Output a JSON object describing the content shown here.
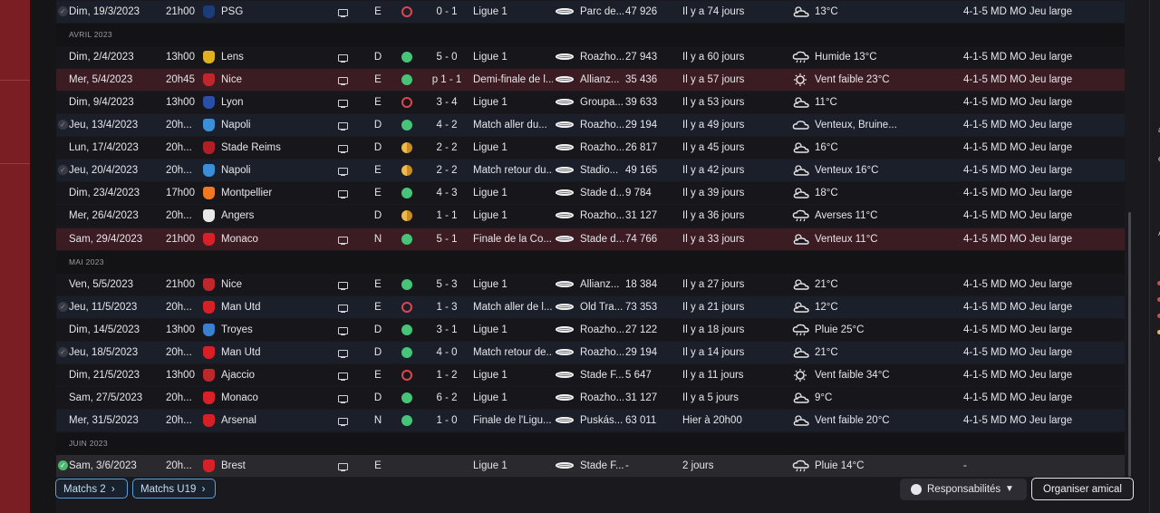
{
  "colors": {
    "accent_red": "#7a1e24",
    "win": "#45c47a",
    "loss": "#e0444f",
    "draw": "#f0b94a",
    "link_blue": "#5aa0d8"
  },
  "rows": [
    {
      "type": "match",
      "date": "Dim, 19/3/2023",
      "time": "21h00",
      "opponent": "PSG",
      "crest_color": "#1b3b7a",
      "venue": "E",
      "result": "l",
      "score": "0 - 1",
      "competition": "Ligue 1",
      "stadium": "Parc de...",
      "attendance": "47 926",
      "ago": "Il y a 74 jours",
      "weather": "13°C",
      "weather_icon": "cloud-sun-icon",
      "tactic": "4-1-5 MD MO Jeu large",
      "bg": "away",
      "check": true,
      "tv": true
    },
    {
      "type": "month",
      "label": "AVRIL 2023"
    },
    {
      "type": "match",
      "date": "Dim, 2/4/2023",
      "time": "13h00",
      "opponent": "Lens",
      "crest_color": "#e0b020",
      "venue": "D",
      "result": "w",
      "score": "5 - 0",
      "competition": "Ligue 1",
      "stadium": "Roazho...",
      "attendance": "27 943",
      "ago": "Il y a 60 jours",
      "weather": "Humide 13°C",
      "weather_icon": "cloud-rain-icon",
      "tactic": "4-1-5 MD MO Jeu large",
      "bg": "home",
      "check": false,
      "tv": true
    },
    {
      "type": "match",
      "date": "Mer, 5/4/2023",
      "time": "20h45",
      "opponent": "Nice",
      "crest_color": "#c0272d",
      "venue": "E",
      "result": "w",
      "score": "p 1 - 1",
      "competition": "Demi-finale de l...",
      "stadium": "Allianz...",
      "attendance": "35 436",
      "ago": "Il y a 57 jours",
      "weather": "Vent faible 23°C",
      "weather_icon": "sun-icon",
      "tactic": "4-1-5 MD MO Jeu large",
      "bg": "cup",
      "check": false,
      "tv": true
    },
    {
      "type": "match",
      "date": "Dim, 9/4/2023",
      "time": "13h00",
      "opponent": "Lyon",
      "crest_color": "#2a4fa8",
      "venue": "E",
      "result": "l",
      "score": "3 - 4",
      "competition": "Ligue 1",
      "stadium": "Groupa...",
      "attendance": "39 633",
      "ago": "Il y a 53 jours",
      "weather": "11°C",
      "weather_icon": "cloud-sun-icon",
      "tactic": "4-1-5 MD MO Jeu large",
      "bg": "home",
      "check": false,
      "tv": true
    },
    {
      "type": "match",
      "date": "Jeu, 13/4/2023",
      "time": "20h...",
      "opponent": "Napoli",
      "crest_color": "#3a8fd8",
      "venue": "D",
      "result": "w",
      "score": "4 - 2",
      "competition": "Match aller du...",
      "stadium": "Roazho...",
      "attendance": "29 194",
      "ago": "Il y a 49 jours",
      "weather": "Venteux, Bruine...",
      "weather_icon": "cloud-icon",
      "tactic": "4-1-5 MD MO Jeu large",
      "bg": "away",
      "check": true,
      "tv": true
    },
    {
      "type": "match",
      "date": "Lun, 17/4/2023",
      "time": "20h...",
      "opponent": "Stade Reims",
      "crest_color": "#b01e28",
      "venue": "D",
      "result": "d",
      "score": "2 - 2",
      "competition": "Ligue 1",
      "stadium": "Roazho...",
      "attendance": "26 817",
      "ago": "Il y a 45 jours",
      "weather": "16°C",
      "weather_icon": "cloud-sun-icon",
      "tactic": "4-1-5 MD MO Jeu large",
      "bg": "home",
      "check": false,
      "tv": true
    },
    {
      "type": "match",
      "date": "Jeu, 20/4/2023",
      "time": "20h...",
      "opponent": "Napoli",
      "crest_color": "#3a8fd8",
      "venue": "E",
      "result": "d",
      "score": "2 - 2",
      "competition": "Match retour du...",
      "stadium": "Stadio...",
      "attendance": "49 165",
      "ago": "Il y a 42 jours",
      "weather": "Venteux 16°C",
      "weather_icon": "cloud-sun-icon",
      "tactic": "4-1-5 MD MO Jeu large",
      "bg": "away",
      "check": true,
      "tv": true
    },
    {
      "type": "match",
      "date": "Dim, 23/4/2023",
      "time": "17h00",
      "opponent": "Montpellier",
      "crest_color": "#f07820",
      "venue": "E",
      "result": "w",
      "score": "4 - 3",
      "competition": "Ligue 1",
      "stadium": "Stade d...",
      "attendance": "9 784",
      "ago": "Il y a 39 jours",
      "weather": "18°C",
      "weather_icon": "cloud-sun-icon",
      "tactic": "4-1-5 MD MO Jeu large",
      "bg": "home",
      "check": false,
      "tv": true
    },
    {
      "type": "match",
      "date": "Mer, 26/4/2023",
      "time": "20h...",
      "opponent": "Angers",
      "crest_color": "#e8e8e8",
      "venue": "D",
      "result": "d",
      "score": "1 - 1",
      "competition": "Ligue 1",
      "stadium": "Roazho...",
      "attendance": "31 127",
      "ago": "Il y a 36 jours",
      "weather": "Averses 11°C",
      "weather_icon": "cloud-rain-icon",
      "tactic": "4-1-5 MD MO Jeu large",
      "bg": "home",
      "check": false,
      "tv": false
    },
    {
      "type": "match",
      "date": "Sam, 29/4/2023",
      "time": "21h00",
      "opponent": "Monaco",
      "crest_color": "#d8202a",
      "venue": "N",
      "result": "w",
      "score": "5 - 1",
      "competition": "Finale de la Co...",
      "stadium": "Stade d...",
      "attendance": "74 766",
      "ago": "Il y a 33 jours",
      "weather": "Venteux 11°C",
      "weather_icon": "cloud-sun-icon",
      "tactic": "4-1-5 MD MO Jeu large",
      "bg": "cup",
      "check": false,
      "tv": true
    },
    {
      "type": "month",
      "label": "MAI 2023"
    },
    {
      "type": "match",
      "date": "Ven, 5/5/2023",
      "time": "21h00",
      "opponent": "Nice",
      "crest_color": "#c0272d",
      "venue": "E",
      "result": "w",
      "score": "5 - 3",
      "competition": "Ligue 1",
      "stadium": "Allianz...",
      "attendance": "18 384",
      "ago": "Il y a 27 jours",
      "weather": "21°C",
      "weather_icon": "cloud-sun-icon",
      "tactic": "4-1-5 MD MO Jeu large",
      "bg": "home",
      "check": false,
      "tv": true
    },
    {
      "type": "match",
      "date": "Jeu, 11/5/2023",
      "time": "20h...",
      "opponent": "Man Utd",
      "crest_color": "#d81f26",
      "venue": "E",
      "result": "l",
      "score": "1 - 3",
      "competition": "Match aller de l...",
      "stadium": "Old Tra...",
      "attendance": "73 353",
      "ago": "Il y a 21 jours",
      "weather": "12°C",
      "weather_icon": "cloud-sun-icon",
      "tactic": "4-1-5 MD MO Jeu large",
      "bg": "away",
      "check": true,
      "tv": true
    },
    {
      "type": "match",
      "date": "Dim, 14/5/2023",
      "time": "13h00",
      "opponent": "Troyes",
      "crest_color": "#3a7fd0",
      "venue": "D",
      "result": "w",
      "score": "3 - 1",
      "competition": "Ligue 1",
      "stadium": "Roazho...",
      "attendance": "27 122",
      "ago": "Il y a 18 jours",
      "weather": "Pluie 25°C",
      "weather_icon": "cloud-rain-icon",
      "tactic": "4-1-5 MD MO Jeu large",
      "bg": "home",
      "check": false,
      "tv": true
    },
    {
      "type": "match",
      "date": "Jeu, 18/5/2023",
      "time": "20h...",
      "opponent": "Man Utd",
      "crest_color": "#d81f26",
      "venue": "D",
      "result": "w",
      "score": "4 - 0",
      "competition": "Match retour de...",
      "stadium": "Roazho...",
      "attendance": "29 194",
      "ago": "Il y a 14 jours",
      "weather": "21°C",
      "weather_icon": "cloud-sun-icon",
      "tactic": "4-1-5 MD MO Jeu large",
      "bg": "away",
      "check": true,
      "tv": true
    },
    {
      "type": "match",
      "date": "Dim, 21/5/2023",
      "time": "13h00",
      "opponent": "Ajaccio",
      "crest_color": "#c0272d",
      "venue": "E",
      "result": "l",
      "score": "1 - 2",
      "competition": "Ligue 1",
      "stadium": "Stade F...",
      "attendance": "5 647",
      "ago": "Il y a 11 jours",
      "weather": "Vent faible 34°C",
      "weather_icon": "sun-icon",
      "tactic": "4-1-5 MD MO Jeu large",
      "bg": "home",
      "check": false,
      "tv": true
    },
    {
      "type": "match",
      "date": "Sam, 27/5/2023",
      "time": "20h...",
      "opponent": "Monaco",
      "crest_color": "#d8202a",
      "venue": "D",
      "result": "w",
      "score": "6 - 2",
      "competition": "Ligue 1",
      "stadium": "Roazho...",
      "attendance": "31 127",
      "ago": "Il y a 5 jours",
      "weather": "9°C",
      "weather_icon": "cloud-sun-icon",
      "tactic": "4-1-5 MD MO Jeu large",
      "bg": "home",
      "check": false,
      "tv": true
    },
    {
      "type": "match",
      "date": "Mer, 31/5/2023",
      "time": "20h...",
      "opponent": "Arsenal",
      "crest_color": "#d81f26",
      "venue": "N",
      "result": "w",
      "score": "1 - 0",
      "competition": "Finale de l'Ligu...",
      "stadium": "Puskás...",
      "attendance": "63 011",
      "ago": "Hier à 20h00",
      "weather": "Vent faible 20°C",
      "weather_icon": "cloud-sun-icon",
      "tactic": "4-1-5 MD MO Jeu large",
      "bg": "away",
      "check": false,
      "tv": true
    },
    {
      "type": "month",
      "label": "JUIN 2023"
    },
    {
      "type": "match",
      "date": "Sam, 3/6/2023",
      "time": "20h...",
      "opponent": "Brest",
      "crest_color": "#d8202a",
      "venue": "E",
      "result": "",
      "score": "",
      "competition": "Ligue 1",
      "stadium": "Stade F...",
      "attendance": "-",
      "ago": "2 jours",
      "weather": "Pluie 14°C",
      "weather_icon": "cloud-rain-icon",
      "tactic": "-",
      "bg": "upcoming",
      "check": true,
      "check_ok": true,
      "tv": true
    }
  ],
  "footer": {
    "matchs2_label": "Matchs 2",
    "matchsU19_label": "Matchs U19",
    "responsibilities_label": "Responsabilités",
    "friendly_label": "Organiser amical"
  }
}
